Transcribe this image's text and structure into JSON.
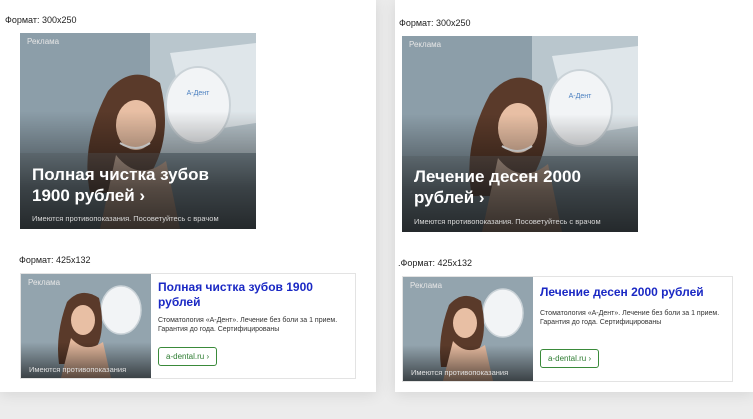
{
  "left": {
    "format_big": "Формат: 300x250",
    "format_small": "Формат: 425x132",
    "ad_label": "Реклама",
    "banner_headline": "Полная чистка зубов 1900 рублей ›",
    "banner_disclaimer": "Имеются противопоказания. Посоветуйтесь с врачом",
    "unit_title": "Полная чистка зубов 1900 рублей",
    "unit_desc": "Стоматология «А-Дент». Лечение без боли за 1 прием. Гарантия до года. Сертифицированы",
    "unit_disclaimer": "Имеются противопоказания",
    "unit_button": "a-dental.ru ›"
  },
  "right": {
    "format_big": "Формат: 300x250",
    "format_small": ".Формат: 425x132",
    "ad_label": "Реклама",
    "banner_headline": "Лечение десен 2000 рублей ›",
    "banner_disclaimer": "Имеются противопоказания. Посоветуйтесь с врачом",
    "unit_title": "Лечение десен 2000 рублей",
    "unit_desc": "Стоматология «А-Дент». Лечение без боли за 1 прием. Гарантия до года. Сертифицированы",
    "unit_disclaimer": "Имеются противопоказания",
    "unit_button": "a-dental.ru ›"
  },
  "mirror_text": "A-Дент",
  "colors": {
    "headline_link": "#1a28c4",
    "button_green": "#2e7d32"
  }
}
